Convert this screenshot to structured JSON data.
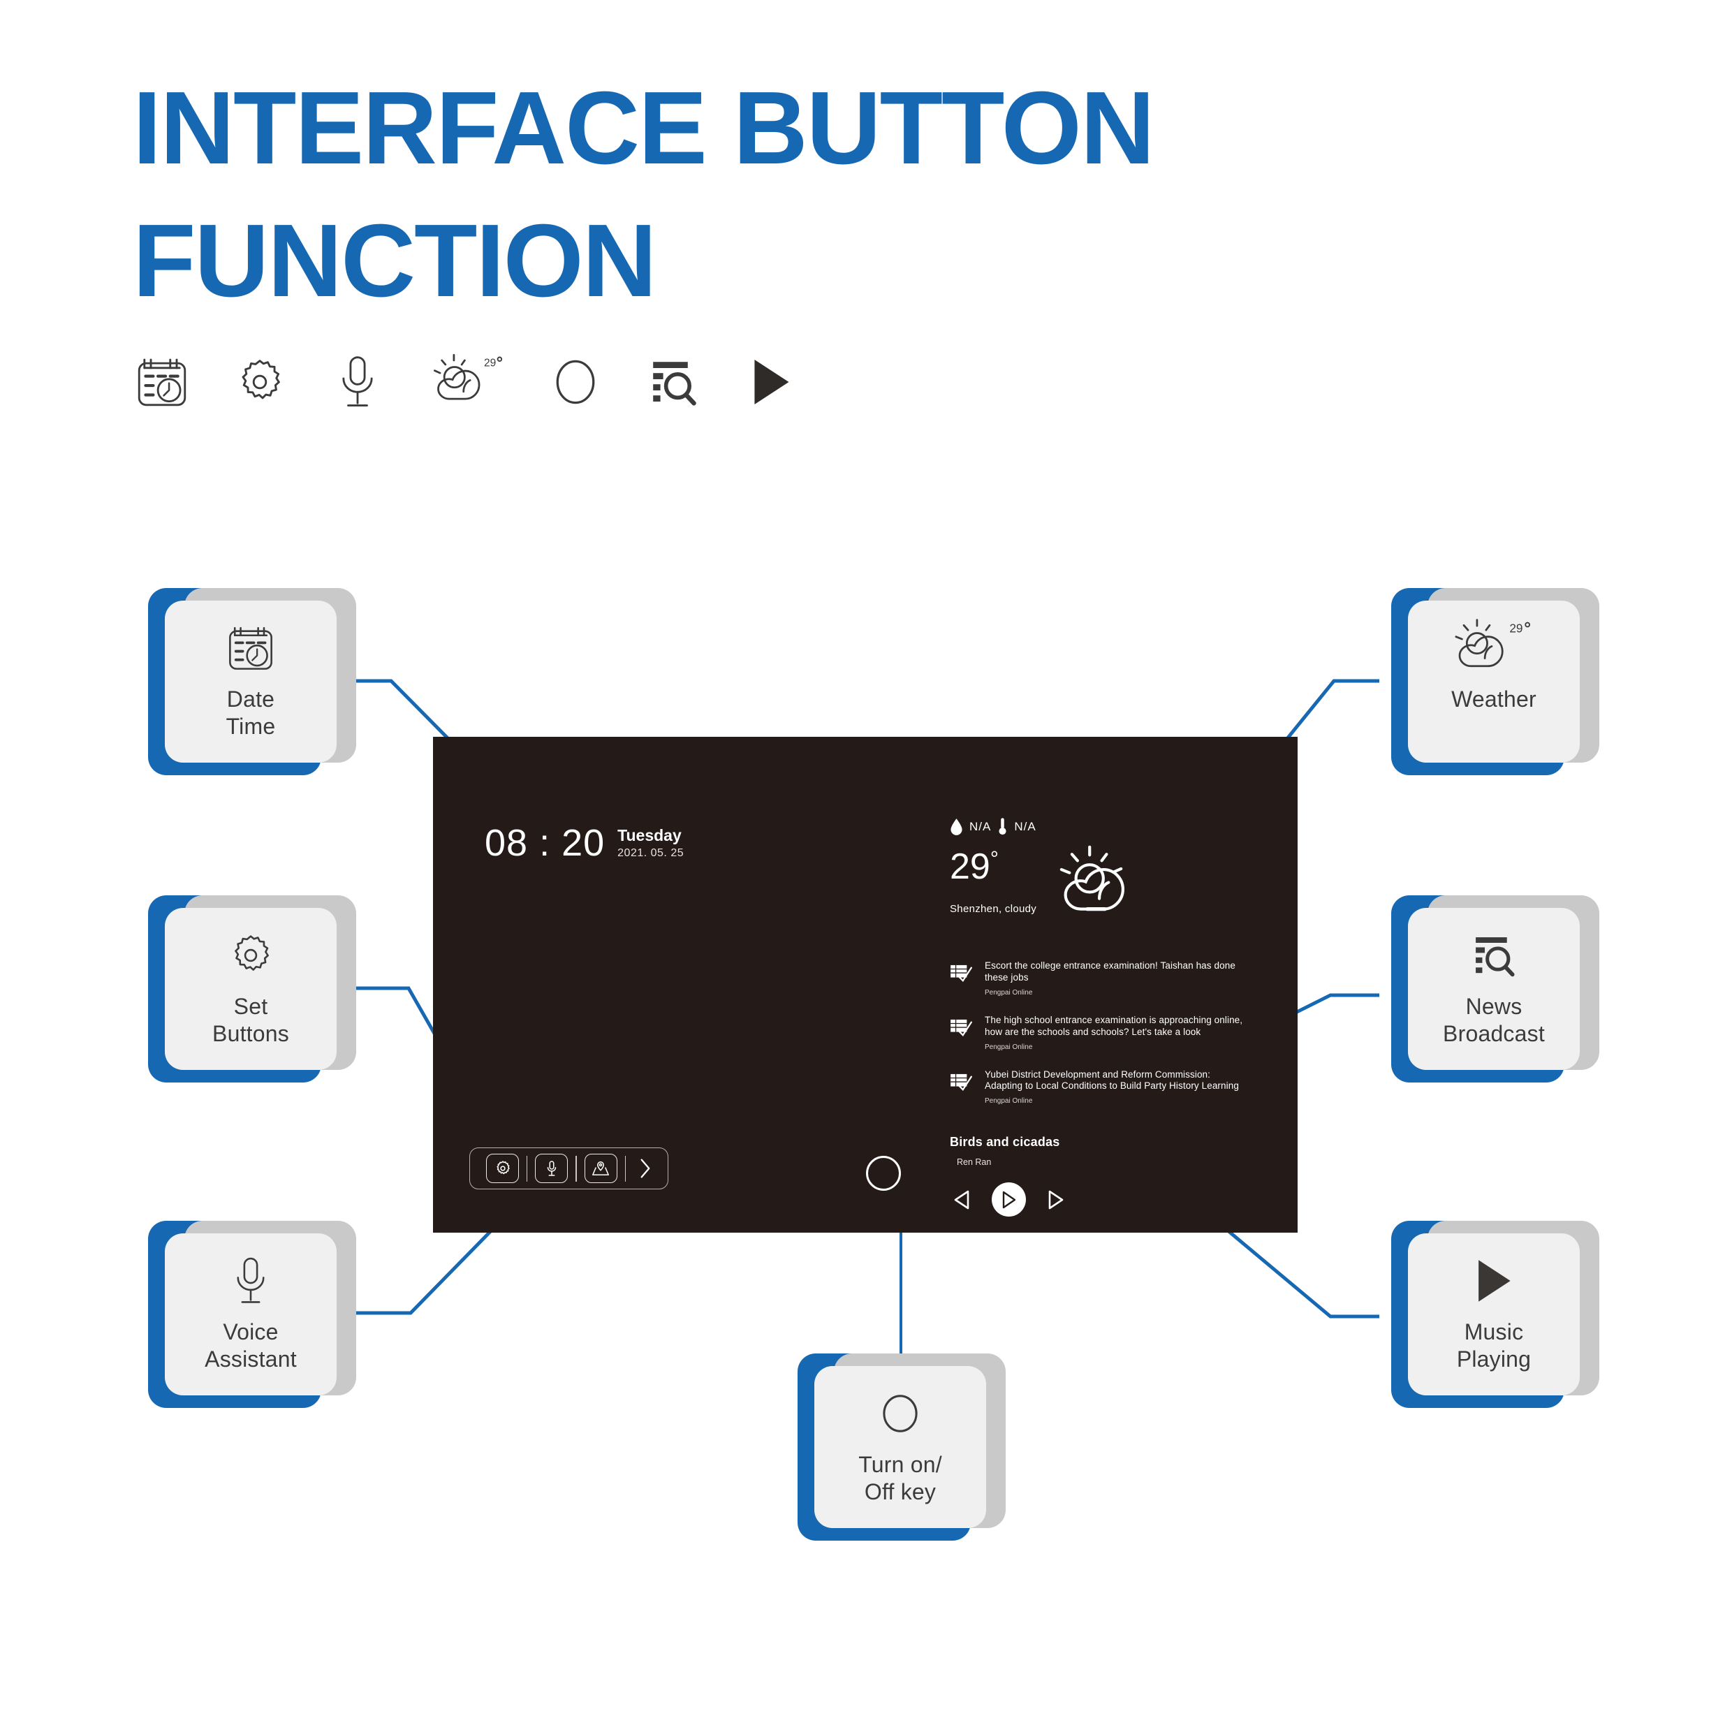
{
  "title": {
    "line1": "INTERFACE BUTTON",
    "line2": "FUNCTION",
    "color": "#1668b3"
  },
  "icon_strip": [
    {
      "name": "calendar-clock-icon",
      "label": "Date Time"
    },
    {
      "name": "gear-icon",
      "label": "Set Buttons"
    },
    {
      "name": "microphone-icon",
      "label": "Voice Assistant"
    },
    {
      "name": "weather-sun-cloud-icon",
      "label": "Weather",
      "badge": "29°"
    },
    {
      "name": "power-circle-icon",
      "label": "Turn on/Off key"
    },
    {
      "name": "news-search-icon",
      "label": "News Broadcast"
    },
    {
      "name": "play-triangle-icon",
      "label": "Music Playing"
    }
  ],
  "cards": [
    {
      "id": "date-time",
      "icon": "calendar-clock-icon",
      "label": "Date\nTime"
    },
    {
      "id": "set-buttons",
      "icon": "gear-icon",
      "label": "Set\nButtons"
    },
    {
      "id": "voice",
      "icon": "microphone-icon",
      "label": "Voice\nAssistant"
    },
    {
      "id": "weather",
      "icon": "weather-sun-cloud-icon",
      "label": "Weather",
      "badge": "29°"
    },
    {
      "id": "news",
      "icon": "news-search-icon",
      "label": "News\nBroadcast"
    },
    {
      "id": "music",
      "icon": "play-triangle-icon",
      "label": "Music\nPlaying"
    },
    {
      "id": "power",
      "icon": "power-circle-icon",
      "label": "Turn on/\nOff key"
    }
  ],
  "screen": {
    "background": "#241a18",
    "clock": {
      "time": "08 : 20",
      "day": "Tuesday",
      "date": "2021. 05. 25"
    },
    "weather": {
      "humidity_label": "N/A",
      "temp_sensor_label": "N/A",
      "temperature": "29",
      "degree": "°",
      "location": "Shenzhen, cloudy"
    },
    "news": [
      {
        "title": "Escort the college entrance examination! Taishan has done these jobs",
        "source": "Pengpai Online"
      },
      {
        "title": "The high school entrance examination is approaching online, how are the schools and schools? Let's take a look",
        "source": "Pengpai Online"
      },
      {
        "title": "Yubei District Development and Reform Commission: Adapting to Local Conditions to Build Party History Learning",
        "source": "Pengpai Online"
      }
    ],
    "music": {
      "track": "Birds and cicadas",
      "artist": "Ren Ran",
      "prev_label": "Previous",
      "play_label": "Play",
      "next_label": "Next"
    },
    "toolbar": [
      {
        "name": "gear-icon",
        "label": "Settings"
      },
      {
        "name": "microphone-icon",
        "label": "Voice"
      },
      {
        "name": "map-pin-icon",
        "label": "Map"
      },
      {
        "name": "chevron-right-icon",
        "label": "More"
      }
    ],
    "power_button_label": "Power"
  },
  "colors": {
    "accent_blue": "#1668b3",
    "card_face": "#f0f0f0",
    "card_shadow": "#c9c9c9",
    "screen_bg": "#241a18",
    "icon_stroke": "#3b3b3b"
  }
}
